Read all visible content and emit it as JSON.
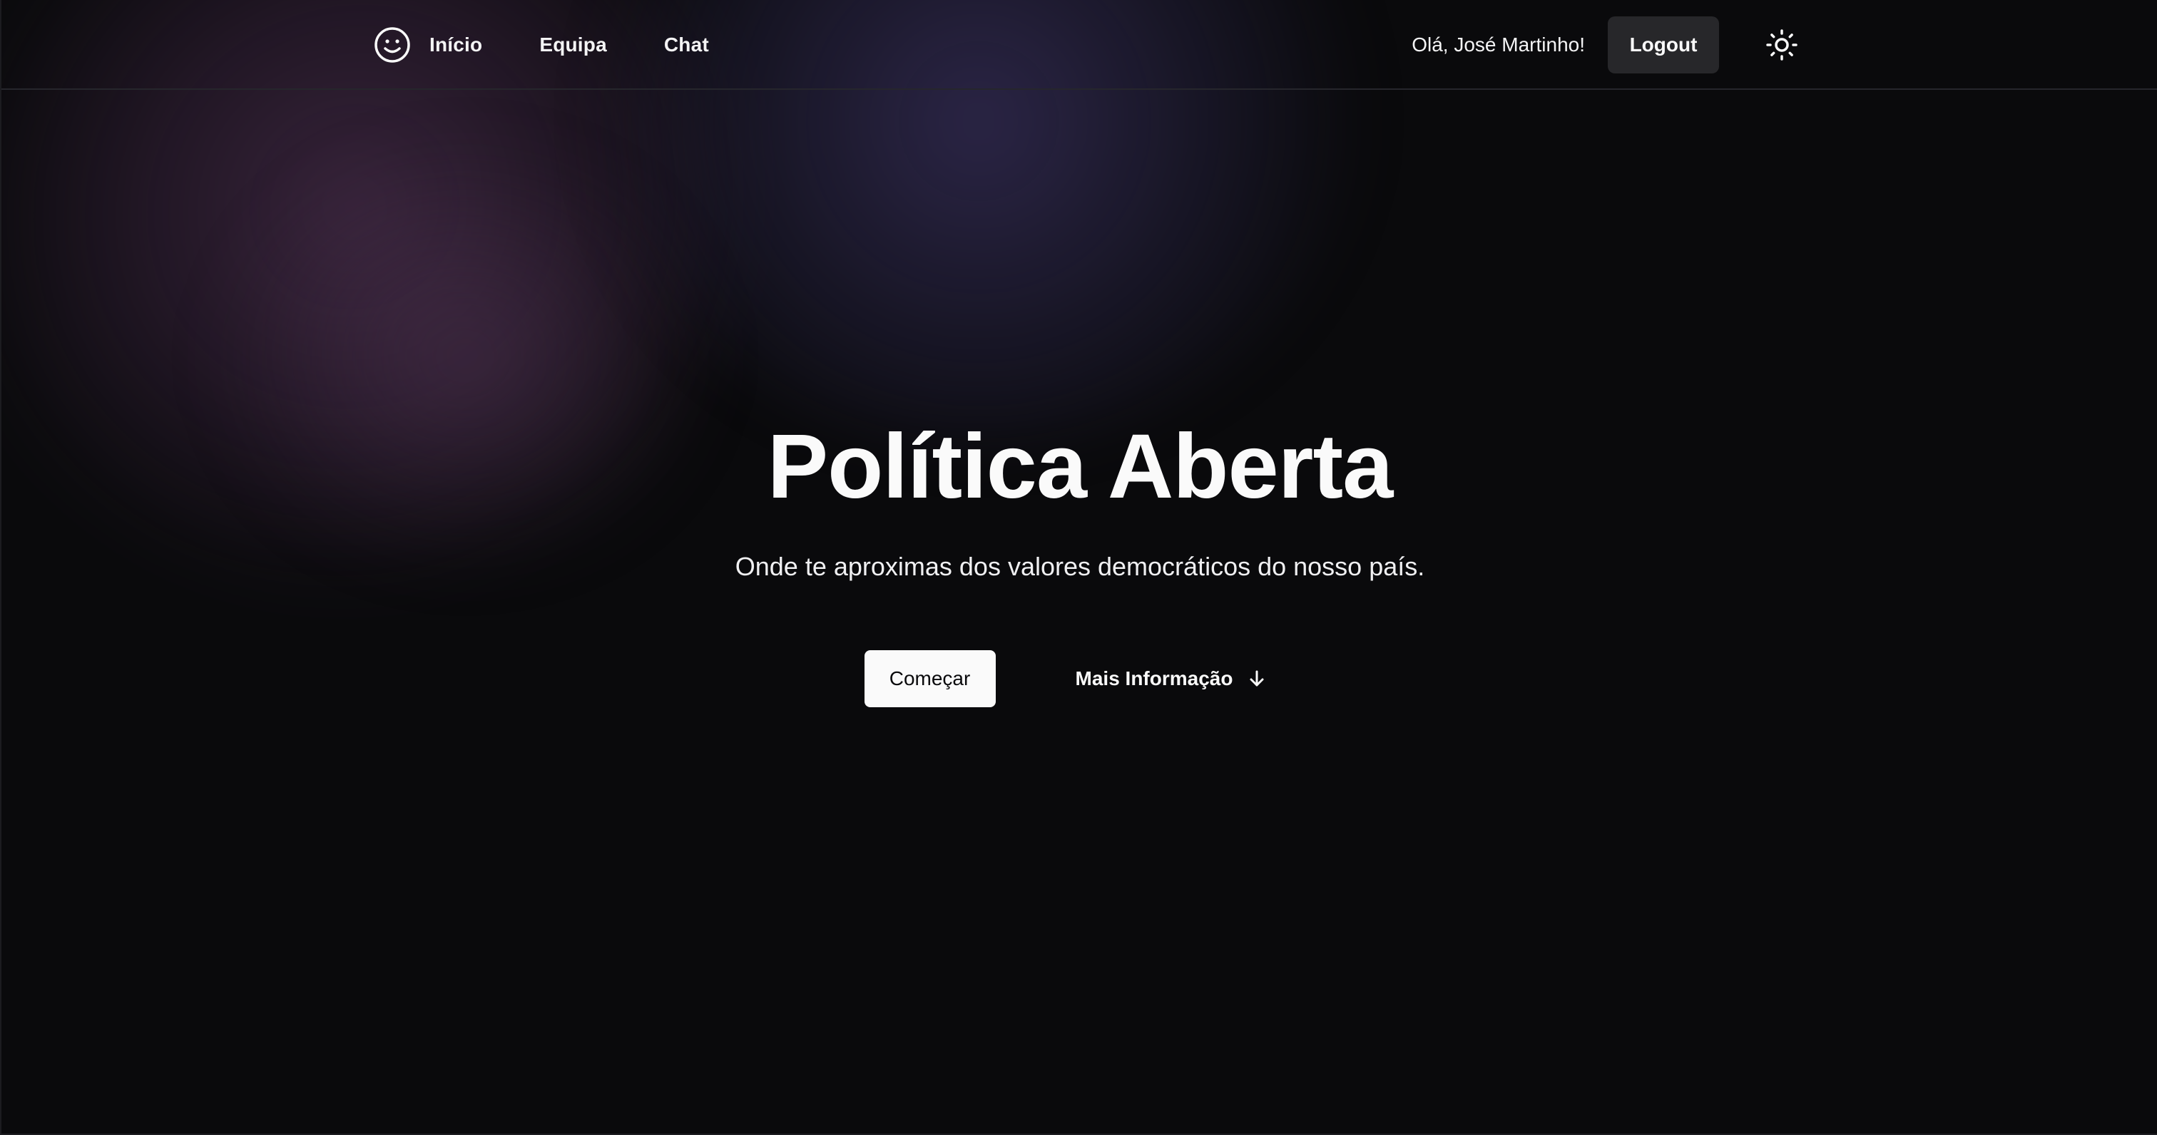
{
  "nav": {
    "logo_icon": "smiley-face-icon",
    "links": [
      {
        "label": "Início"
      },
      {
        "label": "Equipa"
      },
      {
        "label": "Chat"
      }
    ],
    "greeting": "Olá, José Martinho!",
    "logout_label": "Logout",
    "theme_icon": "sun-icon"
  },
  "hero": {
    "title": "Política Aberta",
    "subtitle": "Onde te aproximas dos valores democráticos do nosso país.",
    "start_label": "Começar",
    "more_label": "Mais Informação",
    "more_icon": "arrow-down-icon"
  },
  "colors": {
    "background": "#0a0a0c",
    "button_primary": "#fafafa",
    "button_secondary": "#27272a",
    "glow_purple": "#5c3860",
    "glow_indigo": "#42386e"
  }
}
